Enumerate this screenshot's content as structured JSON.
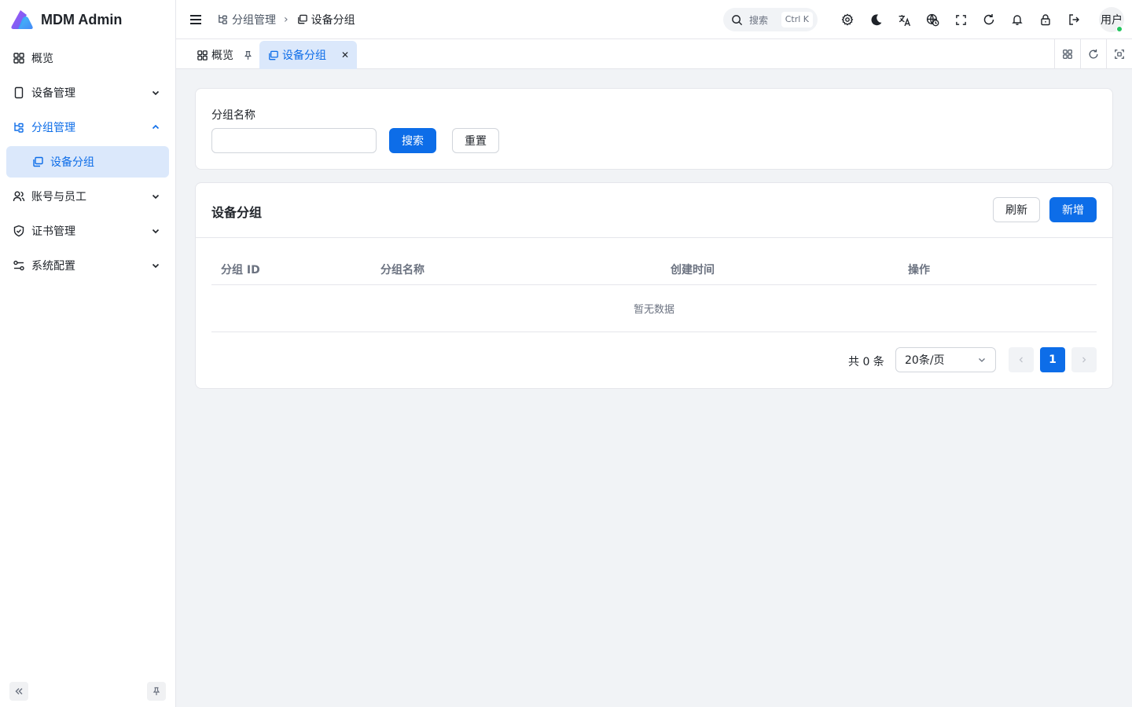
{
  "app": {
    "title": "MDM Admin"
  },
  "sidebar": {
    "items": [
      {
        "label": "概览",
        "icon": "dashboard-icon"
      },
      {
        "label": "设备管理",
        "icon": "device-icon"
      },
      {
        "label": "分组管理",
        "icon": "group-icon"
      },
      {
        "label": "设备分组",
        "icon": "copy-icon"
      },
      {
        "label": "账号与员工",
        "icon": "users-icon"
      },
      {
        "label": "证书管理",
        "icon": "shield-icon"
      },
      {
        "label": "系统配置",
        "icon": "settings-sliders-icon"
      }
    ]
  },
  "header": {
    "breadcrumbs": [
      "分组管理",
      "设备分组"
    ],
    "search_placeholder": "搜索",
    "search_shortcut": "Ctrl K",
    "avatar_text": "用户"
  },
  "tabs": [
    {
      "label": "概览"
    },
    {
      "label": "设备分组"
    }
  ],
  "search_form": {
    "field_label": "分组名称",
    "field_value": "",
    "search_label": "搜索",
    "reset_label": "重置"
  },
  "table": {
    "title": "设备分组",
    "refresh_label": "刷新",
    "add_label": "新增",
    "columns": [
      "分组 ID",
      "分组名称",
      "创建时间",
      "操作"
    ],
    "empty_text": "暂无数据"
  },
  "pagination": {
    "total_text": "共 0 条",
    "page_size": "20条/页",
    "current_page": "1"
  },
  "colors": {
    "accent": "#0d6de8",
    "accent_light": "#dbe8fb",
    "background": "#f1f3f6"
  }
}
